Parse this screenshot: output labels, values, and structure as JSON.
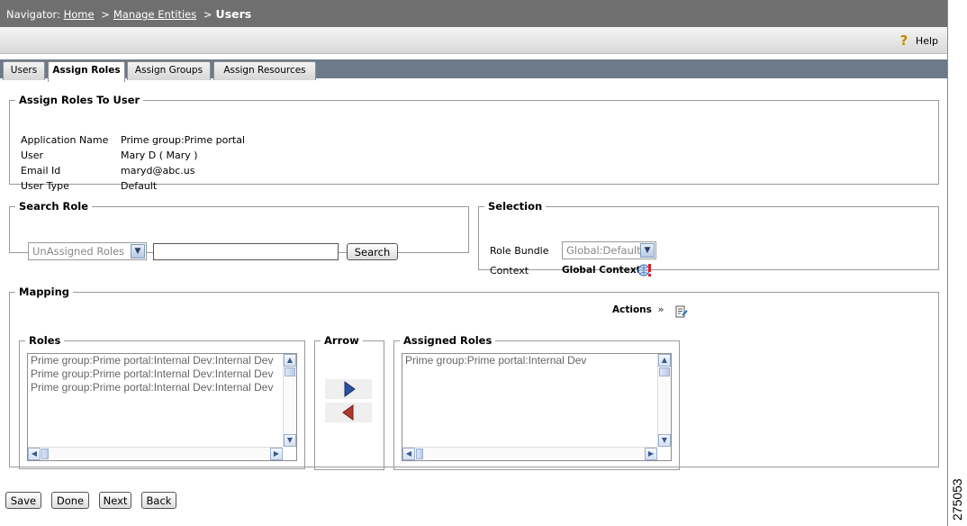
{
  "navigator": {
    "prefix": "Navigator:",
    "home": "Home",
    "sep1": ">",
    "manage": "Manage Entities",
    "sep2": ">",
    "current": "Users"
  },
  "help": {
    "label": "Help"
  },
  "tabs": [
    {
      "label": "Users"
    },
    {
      "label": "Assign Roles",
      "active": true
    },
    {
      "label": "Assign Groups"
    },
    {
      "label": "Assign Resources"
    }
  ],
  "assign_roles": {
    "legend": "Assign Roles To User",
    "fields": [
      {
        "key": "Application Name",
        "value": "Prime group:Prime portal"
      },
      {
        "key": "User",
        "value": "Mary D ( Mary )"
      },
      {
        "key": "Email Id",
        "value": "maryd@abc.us"
      },
      {
        "key": "User Type",
        "value": "Default"
      }
    ]
  },
  "search_role": {
    "legend": "Search Role",
    "filter_value": "UnAssigned Roles",
    "search_text": "",
    "search_button": "Search"
  },
  "selection": {
    "legend": "Selection",
    "role_bundle_label": "Role Bundle",
    "role_bundle_value": "Global:Default",
    "context_label": "Context",
    "context_value": "Global Context"
  },
  "mapping": {
    "legend": "Mapping",
    "actions_label": "Actions",
    "roles_legend": "Roles",
    "roles": [
      "Prime group:Prime portal:Internal Dev:Internal Dev",
      "Prime group:Prime portal:Internal Dev:Internal Dev",
      "Prime group:Prime portal:Internal Dev:Internal Dev"
    ],
    "arrow_legend": "Arrow",
    "assigned_legend": "Assigned Roles",
    "assigned_roles": [
      "Prime group:Prime portal:Internal Dev"
    ]
  },
  "footer_buttons": {
    "save": "Save",
    "done": "Done",
    "next": "Next",
    "back": "Back"
  },
  "figure_id": "275053",
  "colors": {
    "navbar": "#6f6f6f",
    "tabstrip": "#6d7a89",
    "arrow_right": "#2d4fa3",
    "arrow_left": "#b03a2e"
  }
}
